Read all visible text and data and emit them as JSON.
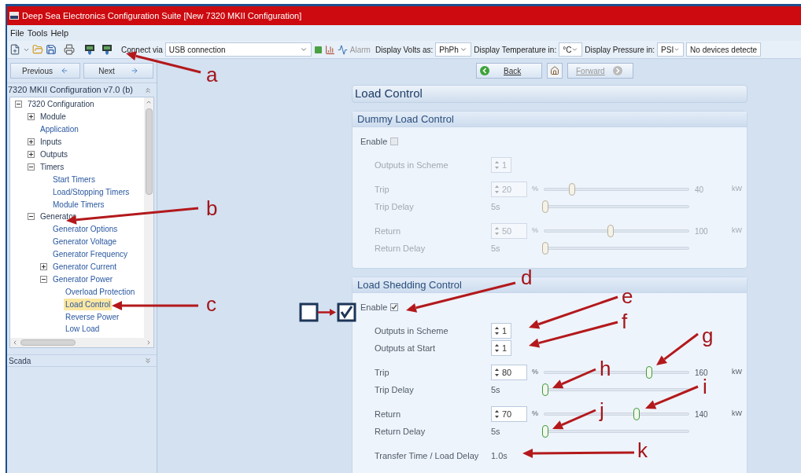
{
  "window": {
    "title": "Deep Sea Electronics Configuration Suite [New 7320 MKII Configuration]"
  },
  "menu": [
    "File",
    "Tools",
    "Help"
  ],
  "toolbar": {
    "connect_label": "Connect via",
    "connection": "USB connection",
    "alarm": "Alarm",
    "volts_label": "Display Volts as:",
    "volts": "PhPh",
    "temp_label": "Display Temperature in:",
    "temp": "°C",
    "pressure_label": "Display Pressure in:",
    "pressure": "PSI",
    "device_status": "No devices detecte"
  },
  "navigation": {
    "previous": "Previous",
    "next": "Next",
    "back": {
      "label": "Back",
      "disabled": false
    },
    "forward": {
      "label": "Forward",
      "disabled": true
    }
  },
  "sidebar": {
    "title": "7320 MKII Configuration v7.0 (b)",
    "bottom_panel": "Scada",
    "tree": [
      {
        "label": "7320 Configuration",
        "expanded": true,
        "selected": false,
        "children": [
          {
            "label": "Module",
            "expanded": false,
            "selected": false
          },
          {
            "label": "Application",
            "selected": false
          },
          {
            "label": "Inputs",
            "expanded": false,
            "selected": false
          },
          {
            "label": "Outputs",
            "expanded": false,
            "selected": false
          },
          {
            "label": "Timers",
            "expanded": true,
            "selected": false,
            "children": [
              {
                "label": "Start Timers",
                "selected": false
              },
              {
                "label": "Load/Stopping Timers",
                "selected": false
              },
              {
                "label": "Module Timers",
                "selected": false
              }
            ]
          },
          {
            "label": "Generator",
            "expanded": true,
            "selected": false,
            "children": [
              {
                "label": "Generator Options",
                "selected": false
              },
              {
                "label": "Generator Voltage",
                "selected": false
              },
              {
                "label": "Generator Frequency",
                "selected": false
              },
              {
                "label": "Generator Current",
                "expanded": false,
                "selected": false
              },
              {
                "label": "Generator Power",
                "expanded": true,
                "selected": false,
                "children": [
                  {
                    "label": "Overload Protection",
                    "selected": false
                  },
                  {
                    "label": "Load Control",
                    "selected": true
                  },
                  {
                    "label": "Reverse Power",
                    "selected": false
                  },
                  {
                    "label": "Low Load",
                    "selected": false
                  }
                ]
              }
            ]
          }
        ]
      }
    ]
  },
  "page_title": "Load Control",
  "sections": [
    {
      "title": "Dummy Load Control",
      "enable_label": "Enable",
      "enabled": false,
      "groups": [
        {
          "fields": [
            {
              "kind": "spinner",
              "label": "Outputs in Scheme",
              "value": "1"
            }
          ]
        },
        {
          "fields": [
            {
              "kind": "slider",
              "label": "Trip",
              "value": "20",
              "unit": "%",
              "level": 0.19,
              "reading": "40",
              "reading_unit": "kW"
            },
            {
              "kind": "delay",
              "label": "Trip Delay",
              "value": "5s",
              "level": 0
            }
          ]
        },
        {
          "fields": [
            {
              "kind": "slider",
              "label": "Return",
              "value": "50",
              "unit": "%",
              "level": 0.46,
              "reading": "100",
              "reading_unit": "kW"
            },
            {
              "kind": "delay",
              "label": "Return Delay",
              "value": "5s",
              "level": 0
            }
          ]
        }
      ]
    },
    {
      "title": "Load Shedding Control",
      "enable_label": "Enable",
      "enabled": true,
      "groups": [
        {
          "fields": [
            {
              "kind": "spinner",
              "label": "Outputs in Scheme",
              "value": "1"
            },
            {
              "kind": "spinner",
              "label": "Outputs at Start",
              "value": "1"
            }
          ]
        },
        {
          "fields": [
            {
              "kind": "slider",
              "label": "Trip",
              "value": "80",
              "unit": "%",
              "level": 0.73,
              "reading": "160",
              "reading_unit": "kW"
            },
            {
              "kind": "delay",
              "label": "Trip Delay",
              "value": "5s",
              "level": 0
            }
          ]
        },
        {
          "fields": [
            {
              "kind": "slider",
              "label": "Return",
              "value": "70",
              "unit": "%",
              "level": 0.64,
              "reading": "140",
              "reading_unit": "kW"
            },
            {
              "kind": "delay",
              "label": "Return Delay",
              "value": "5s",
              "level": 0
            }
          ]
        },
        {
          "fields": [
            {
              "kind": "text",
              "label": "Transfer Time / Load Delay",
              "value": "1.0s"
            }
          ]
        }
      ]
    }
  ],
  "annotations": [
    "a",
    "b",
    "c",
    "d",
    "e",
    "f",
    "g",
    "h",
    "i",
    "j",
    "k"
  ]
}
